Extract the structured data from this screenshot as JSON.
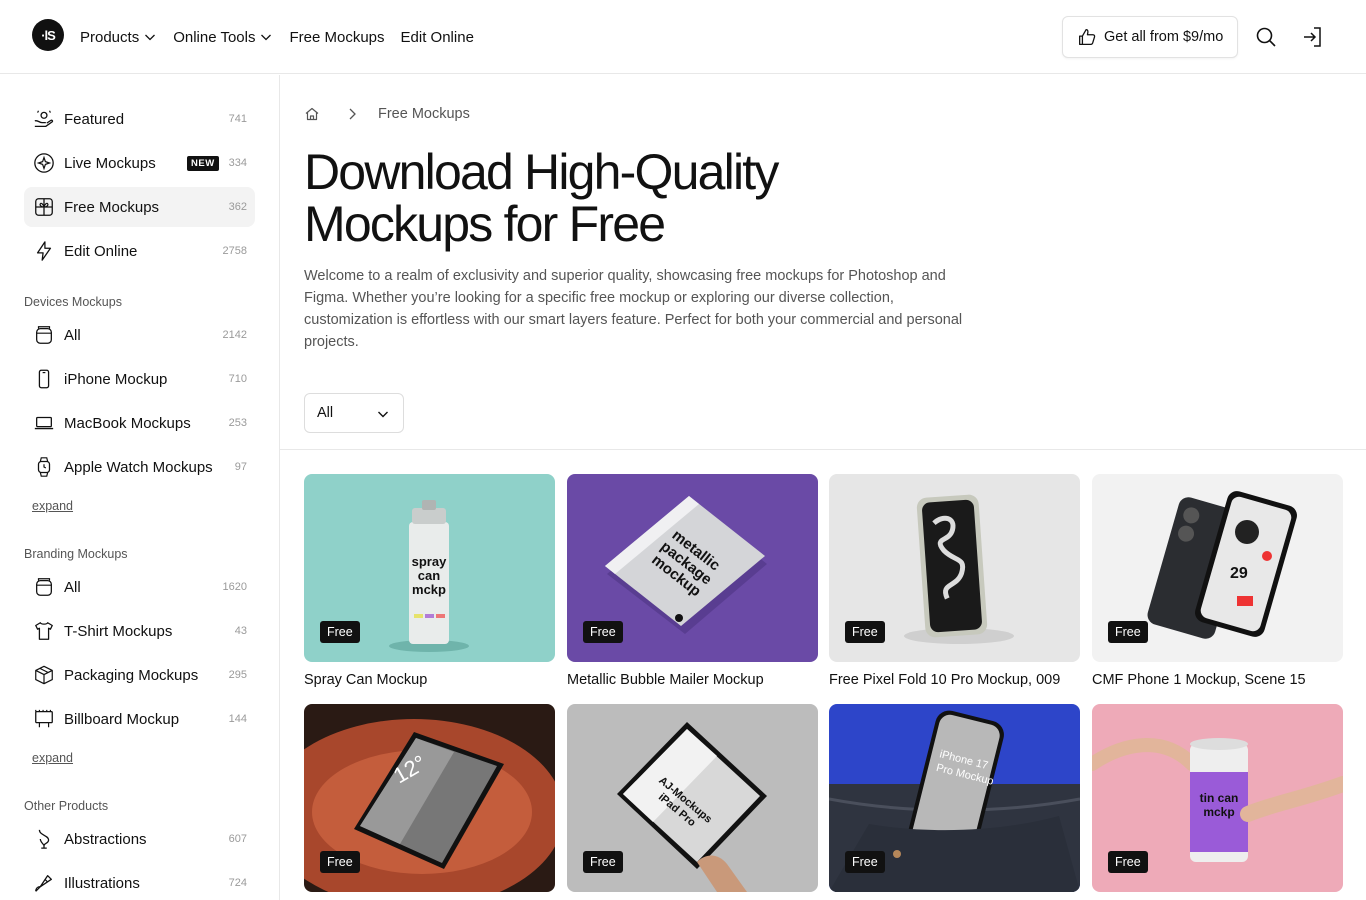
{
  "header": {
    "logo_text": "·lS",
    "nav": [
      {
        "label": "Products",
        "has_dropdown": true
      },
      {
        "label": "Online Tools",
        "has_dropdown": true
      },
      {
        "label": "Free Mockups",
        "has_dropdown": false
      },
      {
        "label": "Edit Online",
        "has_dropdown": false
      }
    ],
    "cta_label": "Get all from $9/mo",
    "icons": [
      "thumbs-up-icon",
      "search-icon",
      "sign-in-icon"
    ]
  },
  "sidebar": {
    "top_items": [
      {
        "label": "Featured",
        "count": "741",
        "icon": "featured-icon"
      },
      {
        "label": "Live Mockups",
        "count": "334",
        "icon": "live-icon",
        "badge": "NEW"
      },
      {
        "label": "Free Mockups",
        "count": "362",
        "icon": "gift-icon",
        "active": true
      },
      {
        "label": "Edit Online",
        "count": "2758",
        "icon": "lightning-icon"
      }
    ],
    "sections": [
      {
        "title": "Devices Mockups",
        "items": [
          {
            "label": "All",
            "count": "2142",
            "icon": "all-icon"
          },
          {
            "label": "iPhone Mockup",
            "count": "710",
            "icon": "phone-icon"
          },
          {
            "label": "MacBook Mockups",
            "count": "253",
            "icon": "laptop-icon"
          },
          {
            "label": "Apple Watch Mockups",
            "count": "97",
            "icon": "watch-icon"
          }
        ],
        "expand_label": "expand"
      },
      {
        "title": "Branding Mockups",
        "items": [
          {
            "label": "All",
            "count": "1620",
            "icon": "all-icon"
          },
          {
            "label": "T-Shirt Mockups",
            "count": "43",
            "icon": "tshirt-icon"
          },
          {
            "label": "Packaging Mockups",
            "count": "295",
            "icon": "box-icon"
          },
          {
            "label": "Billboard Mockup",
            "count": "144",
            "icon": "billboard-icon"
          }
        ],
        "expand_label": "expand"
      },
      {
        "title": "Other Products",
        "items": [
          {
            "label": "Abstractions",
            "count": "607",
            "icon": "abstraction-icon"
          },
          {
            "label": "Illustrations",
            "count": "724",
            "icon": "illustration-icon"
          }
        ]
      }
    ]
  },
  "main": {
    "breadcrumb": {
      "current": "Free Mockups"
    },
    "title": "Download High-Quality Mockups for Free",
    "description": "Welcome to a realm of exclusivity and superior quality, showcasing free mockups for Photoshop and Figma. Whether you’re looking for a specific free mockup or exploring our diverse collection, customization is effortless with our smart layers feature. Perfect for both your commercial and personal projects.",
    "filter": {
      "selected": "All"
    },
    "free_badge": "Free",
    "cards": [
      {
        "title": "Spray Can Mockup",
        "bg": "#8fd1c9",
        "art": "spray",
        "art_text": [
          "spray",
          "can",
          "mckp"
        ]
      },
      {
        "title": "Metallic Bubble Mailer Mockup",
        "bg": "#6a4aa6",
        "art": "mailer",
        "art_text": [
          "metallic",
          "package",
          "mockup"
        ]
      },
      {
        "title": "Free Pixel Fold 10 Pro Mockup, 009",
        "bg": "#e4e4e4",
        "art": "fold"
      },
      {
        "title": "CMF Phone 1 Mockup, Scene 15",
        "bg": "#f0f0f0",
        "art": "cmf",
        "art_text": [
          "29"
        ]
      },
      {
        "title": "",
        "bg": "#2a1a14",
        "art": "ipad-chair",
        "art_text": [
          "12°"
        ]
      },
      {
        "title": "",
        "bg": "#bcbcbc",
        "art": "ipad-hand",
        "art_text": [
          "AJ-Mockups",
          "iPad Pro"
        ]
      },
      {
        "title": "",
        "bg": "#2d45c9",
        "art": "iphone-pocket",
        "art_text": [
          "iPhone 17",
          "Pro Mockup"
        ]
      },
      {
        "title": "",
        "bg": "#eeaab8",
        "art": "tin-can",
        "art_text": [
          "tin can",
          "mckp"
        ]
      }
    ]
  }
}
